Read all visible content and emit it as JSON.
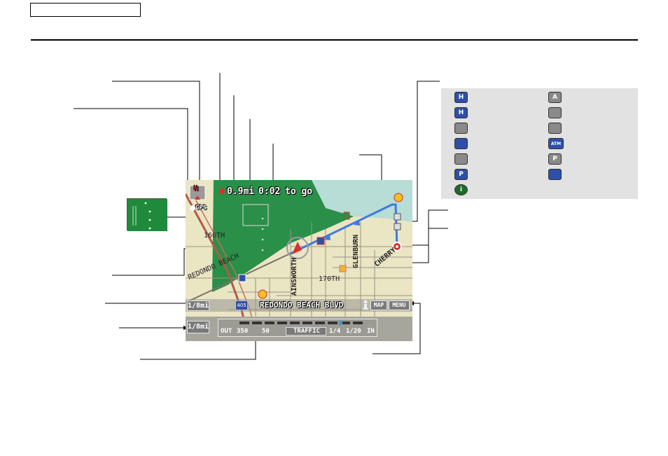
{
  "header": {
    "tab_label": ""
  },
  "map": {
    "distance_remaining": "0.9mi",
    "time_remaining": "0:02",
    "to_go_label": "to go",
    "gps_label": "GPS",
    "compass_letter": "N",
    "streets": {
      "s166th": "166TH",
      "redondo_beach_diag": "REDONDO BEACH",
      "ainsworth": "AINSWORTH",
      "glenburn": "GLENBURN",
      "cherry": "CHERRY",
      "s170th": "170TH"
    },
    "current_street": "REDONDO BEACH BLVD",
    "map_button_label": "MAP",
    "menu_button_label": "MENU",
    "scale_top_label": "1/8mi",
    "scale_bottom_label": "1/8mi",
    "freeway_shield": "405"
  },
  "traffic_bar": {
    "out_label": "OUT",
    "scale_values": [
      "350",
      "50"
    ],
    "traffic_label": "TRAFFIC",
    "right_values": [
      "1/4",
      "1/20"
    ],
    "in_label": "IN"
  },
  "legend": {
    "icons": [
      {
        "name": "honda-dealer-icon",
        "glyph": "H",
        "style": "blue"
      },
      {
        "name": "acura-dealer-icon",
        "glyph": "A",
        "style": "grey"
      },
      {
        "name": "hospital-icon",
        "glyph": "H",
        "style": "blue"
      },
      {
        "name": "school-icon",
        "glyph": "",
        "style": "grey"
      },
      {
        "name": "shopping-cart-icon",
        "glyph": "",
        "style": "grey"
      },
      {
        "name": "hotel-map-icon",
        "glyph": "",
        "style": "grey"
      },
      {
        "name": "gas-station-icon",
        "glyph": "",
        "style": "blue"
      },
      {
        "name": "atm-icon",
        "glyph": "ATM",
        "style": "blue"
      },
      {
        "name": "lodging-bed-icon",
        "glyph": "",
        "style": "grey"
      },
      {
        "name": "parking-icon",
        "glyph": "P",
        "style": "grey"
      },
      {
        "name": "parking-garage-icon",
        "glyph": "P",
        "style": "blue"
      },
      {
        "name": "post-office-icon",
        "glyph": "",
        "style": "blue"
      },
      {
        "name": "information-icon",
        "glyph": "i",
        "style": "green"
      }
    ]
  },
  "colors": {
    "park_green": "#2a8f48",
    "water": "#b8dcd6",
    "route_blue": "#3a7be0",
    "land": "#eae5c3"
  }
}
